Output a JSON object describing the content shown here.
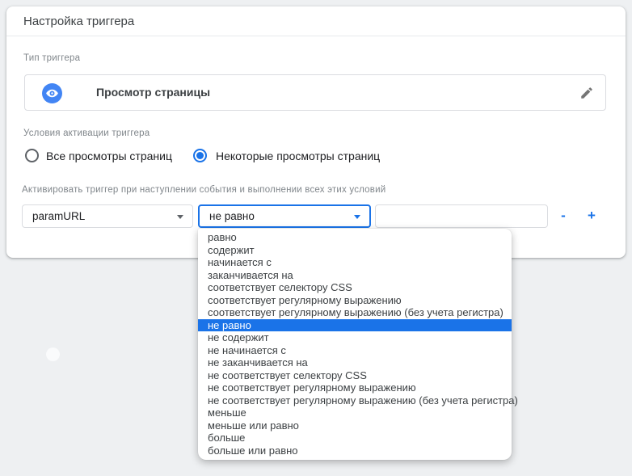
{
  "card": {
    "title": "Настройка триггера",
    "trigger_type": {
      "label": "Тип триггера",
      "value": "Просмотр страницы",
      "icon": "eye-icon",
      "edit_icon": "pencil-icon"
    },
    "conditions": {
      "label": "Условия активации триггера",
      "options": [
        {
          "label": "Все просмотры страниц",
          "selected": false
        },
        {
          "label": "Некоторые просмотры страниц",
          "selected": true
        }
      ]
    },
    "filter": {
      "label": "Активировать триггер при наступлении события и выполнении всех этих условий",
      "variable_select": {
        "value": "paramURL"
      },
      "operator_select": {
        "value": "не равно"
      },
      "value_input": {
        "value": "",
        "placeholder": ""
      },
      "remove_label": "-",
      "add_label": "+"
    }
  },
  "dropdown": {
    "selected_index": 7,
    "selected_value": "не равно",
    "items": [
      "равно",
      "содержит",
      "начинается с",
      "заканчивается на",
      "соответствует селектору CSS",
      "соответствует регулярному выражению",
      "соответствует регулярному выражению (без учета регистра)",
      "не равно",
      "не содержит",
      "не начинается с",
      "не заканчивается на",
      "не соответствует селектору CSS",
      "не соответствует регулярному выражению",
      "не соответствует регулярному выражению (без учета регистра)",
      "меньше",
      "меньше или равно",
      "больше",
      "больше или равно"
    ]
  },
  "colors": {
    "accent_blue": "#1a73e8",
    "icon_blue": "#4285f4",
    "border_gray": "#dadce0",
    "label_gray": "#80868b",
    "text_dark": "#3c4043",
    "page_background": "#eef0f2",
    "highlight_text": "#ffffff"
  }
}
